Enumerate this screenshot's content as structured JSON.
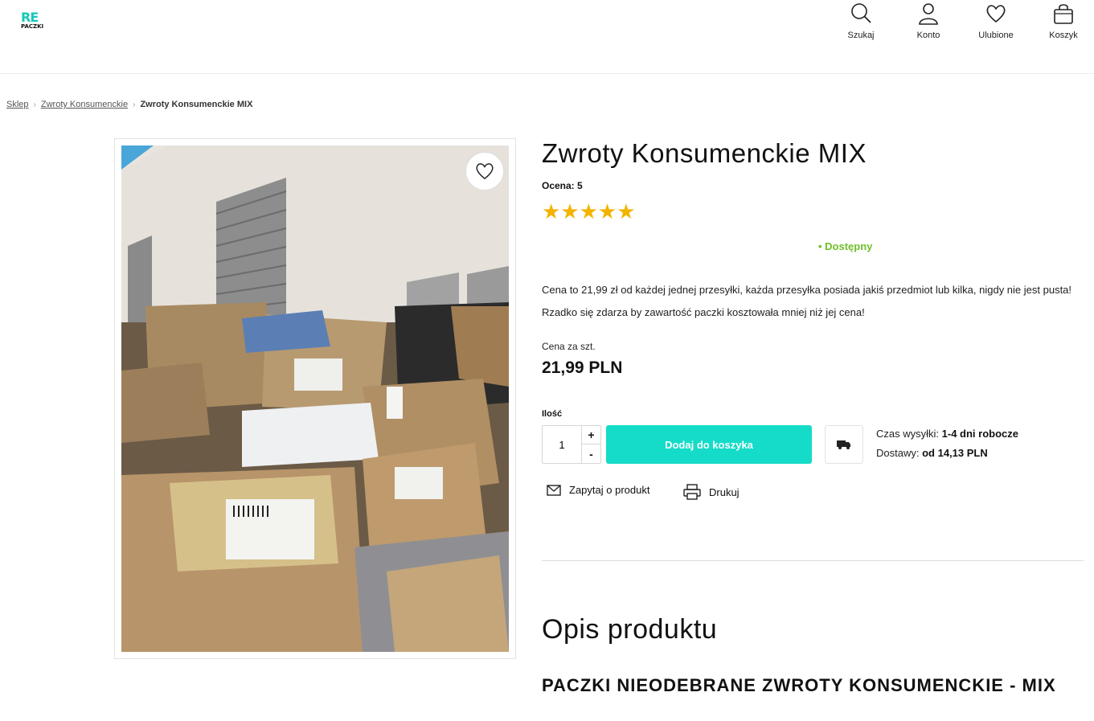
{
  "header": {
    "logo_top": "RE",
    "logo_bottom": "PACZKI",
    "icons": [
      {
        "icon": "search-icon",
        "label": "Szukaj"
      },
      {
        "icon": "user-icon",
        "label": "Konto"
      },
      {
        "icon": "heart-icon",
        "label": "Ulubione"
      },
      {
        "icon": "bag-icon",
        "label": "Koszyk"
      }
    ]
  },
  "breadcrumb": {
    "items": [
      "Sklep",
      "Zwroty Konsumenckie"
    ],
    "current": "Zwroty Konsumenckie MIX"
  },
  "product": {
    "title": "Zwroty Konsumenckie MIX",
    "rating_label": "Ocena: 5",
    "stars": "★★★★★",
    "availability": "• Dostępny",
    "description": "Cena to 21,99 zł od każdej jednej przesyłki, każda przesyłka posiada jakiś przedmiot lub kilka, nigdy nie jest pusta! Rzadko się zdarza by zawartość paczki kosztowała mniej niż jej cena!",
    "price_label": "Cena za szt.",
    "price": "21,99 PLN",
    "qty_label": "Ilość",
    "qty_value": "1",
    "plus": "+",
    "minus": "-",
    "add_to_cart": "Dodaj do koszyka",
    "shipping_time_label": "Czas wysyłki:",
    "shipping_time_value": "1-4 dni robocze",
    "delivery_label": "Dostawy:",
    "delivery_value": "od 14,13 PLN",
    "ask_label": "Zapytaj o produkt",
    "print_label": "Drukuj"
  },
  "description_section": {
    "heading": "Opis produktu",
    "subheading": "PACZKI NIEODEBRANE ZWROTY KONSUMENCKIE - MIX"
  },
  "colors": {
    "accent": "#14dcc8",
    "available": "#6fbf2a",
    "stars": "#f2b400"
  }
}
